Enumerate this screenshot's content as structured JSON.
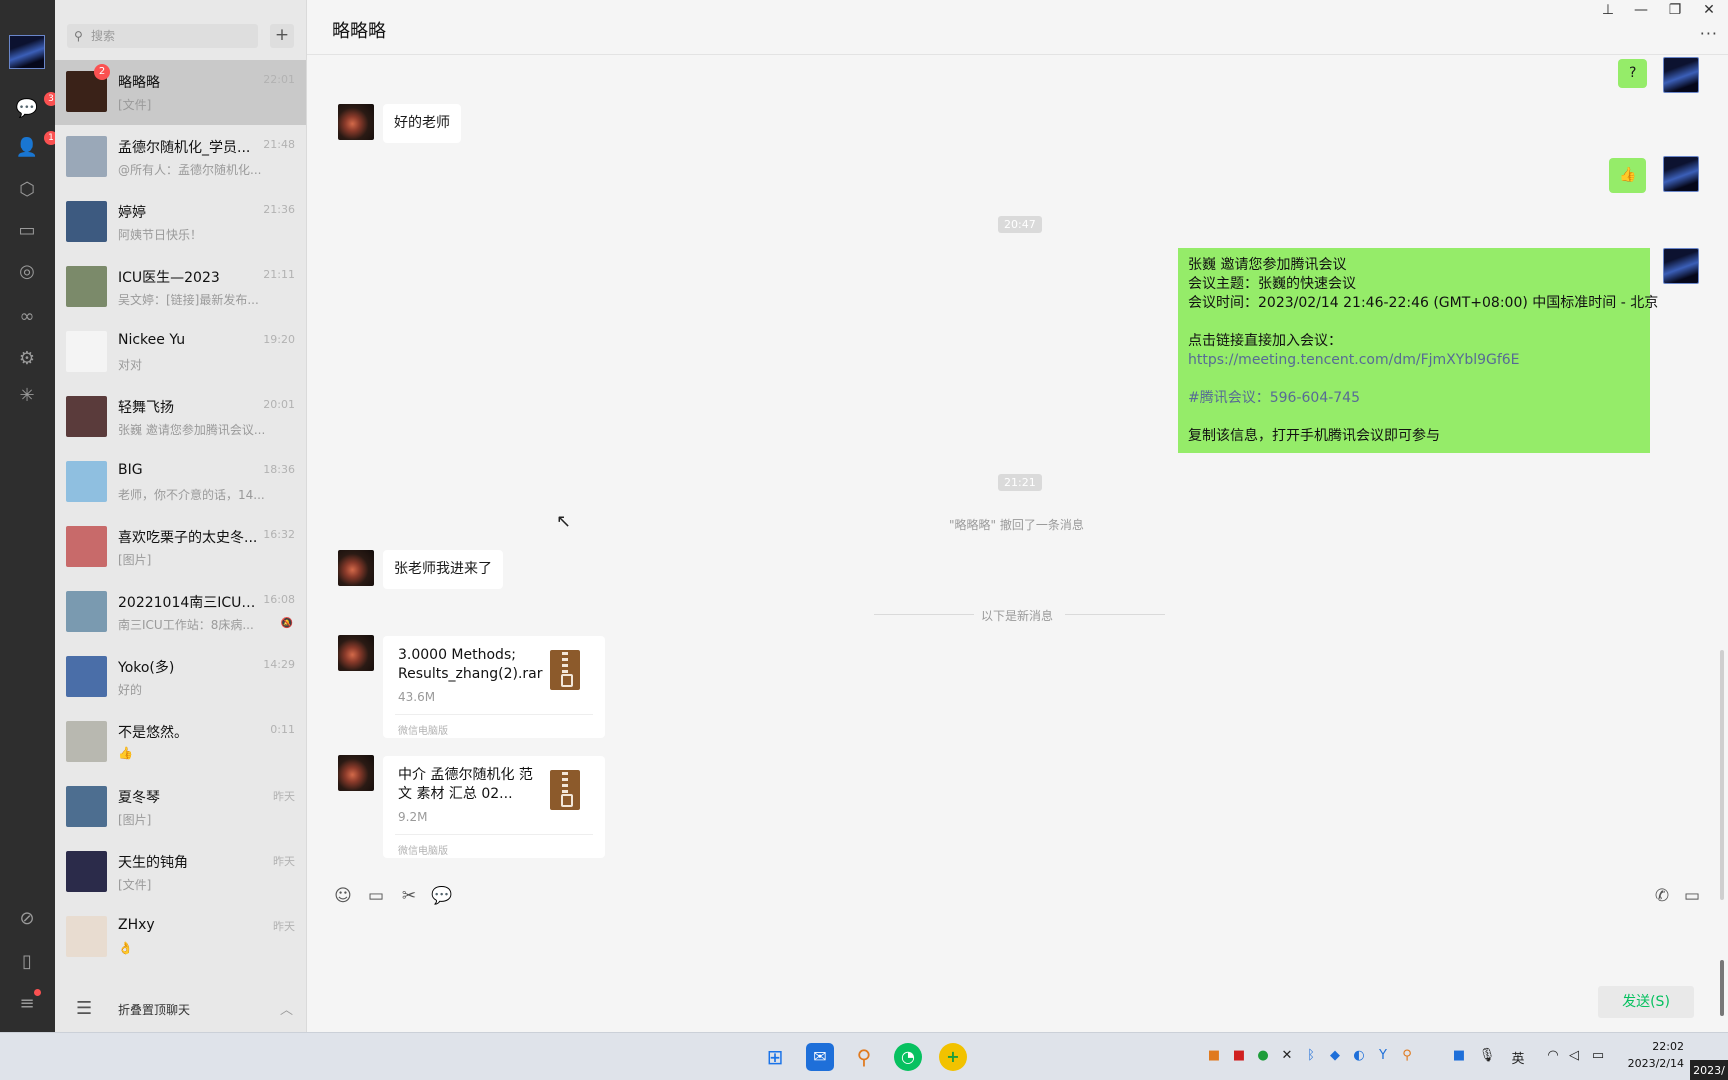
{
  "rail": {
    "chat_badge": "3",
    "contacts_badge": "1",
    "icons": [
      "chat-icon",
      "contacts-icon",
      "cube-icon",
      "folder-icon",
      "moments-icon",
      "channels-icon",
      "mini-program-icon",
      "search-feature-icon",
      "link-icon",
      "phone-icon",
      "menu-icon"
    ]
  },
  "search": {
    "placeholder": "搜索",
    "add_label": "+"
  },
  "chats": [
    {
      "name": "略略略",
      "time": "22:01",
      "preview": "[文件]",
      "badge": "2",
      "avatar_color": "#3a2218"
    },
    {
      "name": "孟德尔随机化_学员...",
      "time": "21:48",
      "preview": "@所有人：孟德尔随机化...",
      "badge": "",
      "avatar_color": "#9aa8b8"
    },
    {
      "name": "婷婷",
      "time": "21:36",
      "preview": "阿姨节日快乐！",
      "badge": "",
      "avatar_color": "#3d5a80"
    },
    {
      "name": "ICU医生—2023",
      "time": "21:11",
      "preview": "吴文婷：[链接]最新发布...",
      "badge": "",
      "avatar_color": "#7b8a6a"
    },
    {
      "name": "Nickee Yu",
      "time": "19:20",
      "preview": "对对",
      "badge": "",
      "avatar_color": "#f4f4f4"
    },
    {
      "name": "轻舞飞扬",
      "time": "20:01",
      "preview": "张巍 邀请您参加腾讯会议...",
      "badge": "",
      "avatar_color": "#5a3b3b"
    },
    {
      "name": "BIG",
      "time": "18:36",
      "preview": "老师，你不介意的话，14...",
      "badge": "",
      "avatar_color": "#8fbfe0"
    },
    {
      "name": "喜欢吃栗子的太史冬...",
      "time": "16:32",
      "preview": "[图片]",
      "badge": "",
      "avatar_color": "#c86a6a"
    },
    {
      "name": "20221014南三ICU医...",
      "time": "16:08",
      "preview": "南三ICU工作站：8床病...",
      "badge": "",
      "avatar_color": "#7a9ab0"
    },
    {
      "name": "Yoko(多)",
      "time": "14:29",
      "preview": "好的",
      "badge": "",
      "avatar_color": "#4a6ea8"
    },
    {
      "name": "不是悠然。",
      "time": "0:11",
      "preview": "👍",
      "badge": "",
      "avatar_color": "#b8b8b0"
    },
    {
      "name": "夏冬琴",
      "time": "昨天",
      "preview": "[图片]",
      "badge": "",
      "avatar_color": "#4d6e90"
    },
    {
      "name": "天生的钝角",
      "time": "昨天",
      "preview": "[文件]",
      "badge": "",
      "avatar_color": "#2b2b4a"
    },
    {
      "name": "ZHxy",
      "time": "昨天",
      "preview": "👌",
      "badge": "",
      "avatar_color": "#e8dcd0"
    }
  ],
  "fold_label": "折叠置顶聊天",
  "header": {
    "title": "略略略",
    "more": "···"
  },
  "messages": {
    "q_mark": "?",
    "good_teacher": "好的老师",
    "thumbs": "👍",
    "ts1": "20:47",
    "ts2": "21:21",
    "meeting": {
      "l1": "张巍 邀请您参加腾讯会议",
      "l2": "会议主题：张巍的快速会议",
      "l3": "会议时间：2023/02/14 21:46-22:46 (GMT+08:00) 中国标准时间 - 北京",
      "l4": "点击链接直接加入会议：",
      "link": "https://meeting.tencent.com/dm/FjmXYbl9Gf6E",
      "id": "#腾讯会议：596-604-745",
      "l6": "复制该信息，打开手机腾讯会议即可参与"
    },
    "recall": "\"略略略\" 撤回了一条消息",
    "zhang_in": "张老师我进来了",
    "new_divider": "以下是新消息",
    "file1": {
      "name": "3.0000  Methods; Results_zhang(2).rar",
      "size": "43.6M",
      "source": "微信电脑版"
    },
    "file2": {
      "name": "中介  孟德尔随机化 范文  素材  汇总  02...",
      "size": "9.2M",
      "source": "微信电脑版"
    }
  },
  "toolbar": {
    "send_label": "发送(S)"
  },
  "taskbar": {
    "apps": [
      "start-icon",
      "mail-icon",
      "search-app-icon",
      "wechat-icon",
      "app-plus-icon"
    ],
    "ime": "英",
    "time": "22:02",
    "date": "2023/2/14",
    "date_badge": "2023/"
  }
}
